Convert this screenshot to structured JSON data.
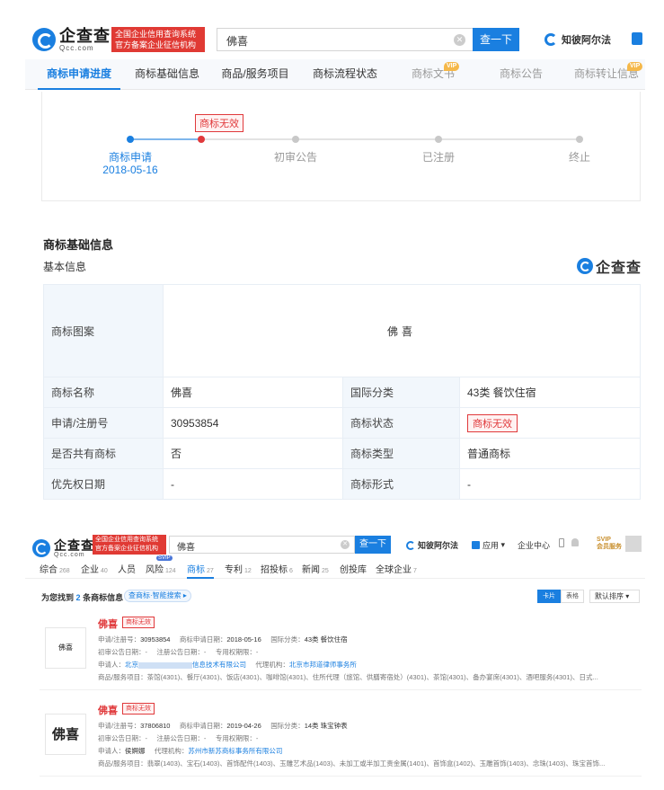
{
  "top": {
    "logo_cn": "企查查",
    "logo_sub": "Qcc.com",
    "red_tag_line1": "全国企业信用查询系统",
    "red_tag_line2": "官方备案企业征信机构",
    "search_value": "佛喜",
    "search_button": "查一下",
    "zhibi_link": "知彼阿尔法",
    "tabs": [
      {
        "label": "商标申请进度"
      },
      {
        "label": "商标基础信息"
      },
      {
        "label": "商品/服务项目"
      },
      {
        "label": "商标流程状态"
      },
      {
        "label": "商标文书",
        "vip": "VIP"
      },
      {
        "label": "商标公告"
      },
      {
        "label": "商标转让信息",
        "vip": "VIP"
      }
    ],
    "progress": {
      "badge": "商标无效",
      "stages": [
        {
          "label": "商标申请",
          "date": "2018-05-16"
        },
        {
          "label": "初审公告"
        },
        {
          "label": "已注册"
        },
        {
          "label": "终止"
        }
      ]
    },
    "section_title": "商标基础信息",
    "sub_title": "基本信息",
    "watermark": "企查查",
    "table": {
      "image_label": "商标图案",
      "image_text": "佛喜",
      "rows": [
        {
          "k1": "商标名称",
          "v1": "佛喜",
          "k2": "国际分类",
          "v2": "43类 餐饮住宿"
        },
        {
          "k1": "申请/注册号",
          "v1": "30953854",
          "k2": "商标状态",
          "v2": "商标无效"
        },
        {
          "k1": "是否共有商标",
          "v1": "否",
          "k2": "商标类型",
          "v2": "普通商标"
        },
        {
          "k1": "优先权日期",
          "v1": "-",
          "k2": "商标形式",
          "v2": "-"
        }
      ]
    }
  },
  "bottom": {
    "logo_cn": "企查查",
    "logo_sub": "Qcc.com",
    "red_tag_line1": "全国企业信用查询系统",
    "red_tag_line2": "官方备案企业征信机构",
    "search_value": "佛喜",
    "search_button": "查一下",
    "zhibi_link": "知彼阿尔法",
    "app_menu": "应用",
    "enterprise_center": "企业中心",
    "svip_line1": "SVIP",
    "svip_line2": "会员服务",
    "nav": [
      {
        "label": "综合",
        "count": "268"
      },
      {
        "label": "企业",
        "count": "40"
      },
      {
        "label": "人员",
        "count": ""
      },
      {
        "label": "风险",
        "count": "124",
        "tag": "SVIP"
      },
      {
        "label": "商标",
        "count": "27"
      },
      {
        "label": "专利",
        "count": "12"
      },
      {
        "label": "招投标",
        "count": "6"
      },
      {
        "label": "新闻",
        "count": "25"
      },
      {
        "label": "创投库",
        "count": ""
      },
      {
        "label": "全球企业",
        "count": "7"
      }
    ],
    "found_prefix": "为您找到",
    "found_count": "2",
    "found_suffix": "条商标信息",
    "smart_search": "查商标·智能搜索",
    "view_card": "卡片",
    "view_table": "表格",
    "sort": "默认排序",
    "results": [
      {
        "thumb": "佛喜",
        "title": "佛喜",
        "badge": "商标无效",
        "reg_no_label": "申请/注册号：",
        "reg_no": "30953854",
        "apply_date_label": "商标申请日期：",
        "apply_date": "2018-05-16",
        "class_label": "国际分类：",
        "class": "43类 餐饮住宿",
        "pub_date_label": "初审公告日期：",
        "pub_date": "-",
        "reg_pub_label": "注册公告日期：",
        "reg_pub": "-",
        "exclusive_label": "专用权期限：",
        "exclusive": "-",
        "applicant_label": "申请人：",
        "applicant_prefix": "北京",
        "applicant_suffix": "信息技术有限公司",
        "agent_label": "代理机构：",
        "agent": "北京市邦道律师事务所",
        "goods_label": "商品/服务项目：",
        "goods": "茶馆(4301)、餐厅(4301)、饭店(4301)、咖啡馆(4301)、住所代理（旅馆、供膳寄宿处）(4301)、茶馆(4301)、备办宴席(4301)、酒吧服务(4301)、日式..."
      },
      {
        "thumb": "佛喜",
        "title": "佛喜",
        "badge": "商标无效",
        "reg_no_label": "申请/注册号：",
        "reg_no": "37806810",
        "apply_date_label": "商标申请日期：",
        "apply_date": "2019-04-26",
        "class_label": "国际分类：",
        "class": "14类 珠宝钟表",
        "pub_date_label": "初审公告日期：",
        "pub_date": "-",
        "reg_pub_label": "注册公告日期：",
        "reg_pub": "-",
        "exclusive_label": "专用权期限：",
        "exclusive": "-",
        "applicant_label": "申请人：",
        "applicant_prefix": "侯婀娜",
        "applicant_suffix": "",
        "agent_label": "代理机构：",
        "agent": "苏州市新苏商标事务所有限公司",
        "goods_label": "商品/服务项目：",
        "goods": "翡翠(1403)、宝石(1403)、首饰配件(1403)、玉雕艺术品(1403)、未加工或半加工贵金属(1401)、首饰盒(1402)、玉雕首饰(1403)、念珠(1403)、珠宝首饰..."
      }
    ]
  }
}
